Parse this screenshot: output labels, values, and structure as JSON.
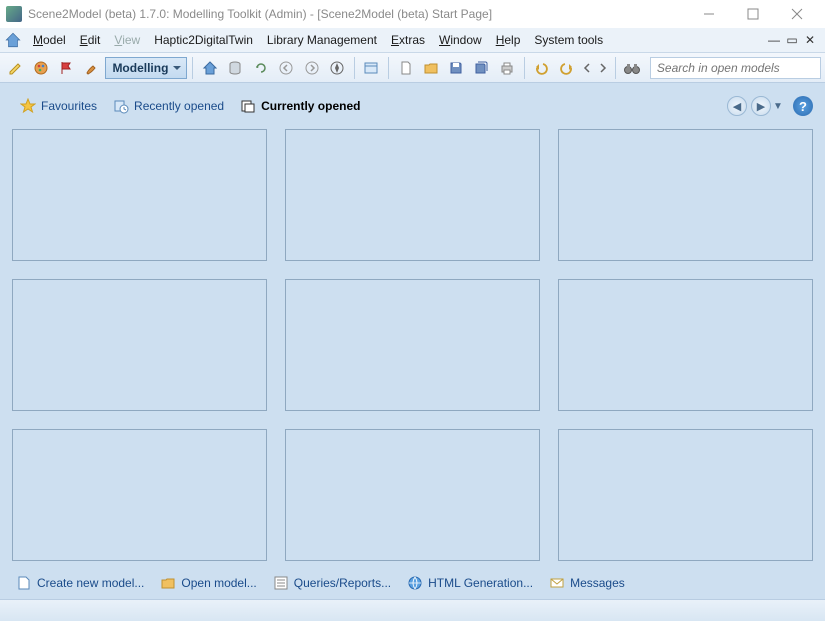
{
  "titlebar": {
    "text": "Scene2Model (beta) 1.7.0: Modelling Toolkit (Admin) - [Scene2Model (beta) Start Page]"
  },
  "menus": {
    "model": "Model",
    "edit": "Edit",
    "view": "View",
    "haptic": "Haptic2DigitalTwin",
    "library": "Library Management",
    "extras": "Extras",
    "window": "Window",
    "help": "Help",
    "systools": "System tools"
  },
  "toolbar": {
    "mode": "Modelling",
    "search_placeholder": "Search in open models"
  },
  "tabs": {
    "favourites": "Favourites",
    "recently": "Recently opened",
    "currently": "Currently opened"
  },
  "bottom": {
    "create": "Create new model...",
    "open": "Open model...",
    "queries": "Queries/Reports...",
    "html": "HTML Generation...",
    "messages": "Messages"
  },
  "help_glyph": "?"
}
